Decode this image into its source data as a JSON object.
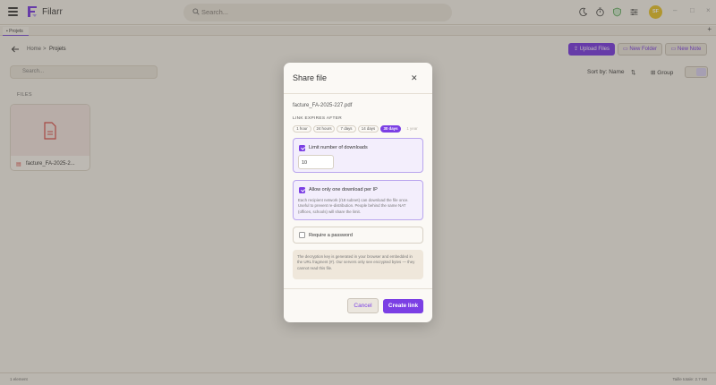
{
  "app": {
    "title": "Filarr",
    "avatar_initials": "SF"
  },
  "search": {
    "placeholder": "Search..."
  },
  "tabs": [
    {
      "label": "Projets"
    }
  ],
  "breadcrumb": {
    "home": "Home",
    "separator": ">",
    "current": "Projets"
  },
  "toolbar": {
    "upload_label": "Upload Files",
    "new_folder_label": "New Folder",
    "new_note_label": "New Note"
  },
  "filter": {
    "placeholder": "Search..."
  },
  "sort": {
    "label": "Sort by: Name"
  },
  "group": {
    "label": "Group"
  },
  "files": {
    "section_label": "FILES",
    "items": [
      {
        "name": "facture_FA-2025-2..."
      }
    ]
  },
  "status": {
    "left": "1 element",
    "right": "Taille totale: 2.7 KB"
  },
  "modal": {
    "title": "Share file",
    "filename": "facture_FA-2025-227.pdf",
    "expires_label": "LINK EXPIRES AFTER",
    "expiry_options": [
      {
        "label": "1 hour",
        "state": "normal"
      },
      {
        "label": "24 hours",
        "state": "normal"
      },
      {
        "label": "7 days",
        "state": "normal"
      },
      {
        "label": "14 days",
        "state": "normal"
      },
      {
        "label": "30 days",
        "state": "selected"
      },
      {
        "label": "1 year",
        "state": "disabled"
      }
    ],
    "limit_downloads": {
      "label": "Limit number of downloads",
      "checked": true,
      "value": "10"
    },
    "one_per_ip": {
      "label": "Allow only one download per IP",
      "checked": true,
      "description": "Each recipient network (/18 subnet) can download the file once. Useful to prevent re-distribution. People behind the same NAT (offices, schools) will share the limit."
    },
    "password": {
      "label": "Require a password",
      "checked": false
    },
    "info": "The decryption key is generated in your browser and embedded in the URL fragment (#). Our servers only see encrypted bytes — they cannot read this file.",
    "cancel_label": "Cancel",
    "create_label": "Create link"
  },
  "colors": {
    "accent": "#7b3fe4",
    "avatar": "#e8c531",
    "background": "#f6f3ee"
  }
}
